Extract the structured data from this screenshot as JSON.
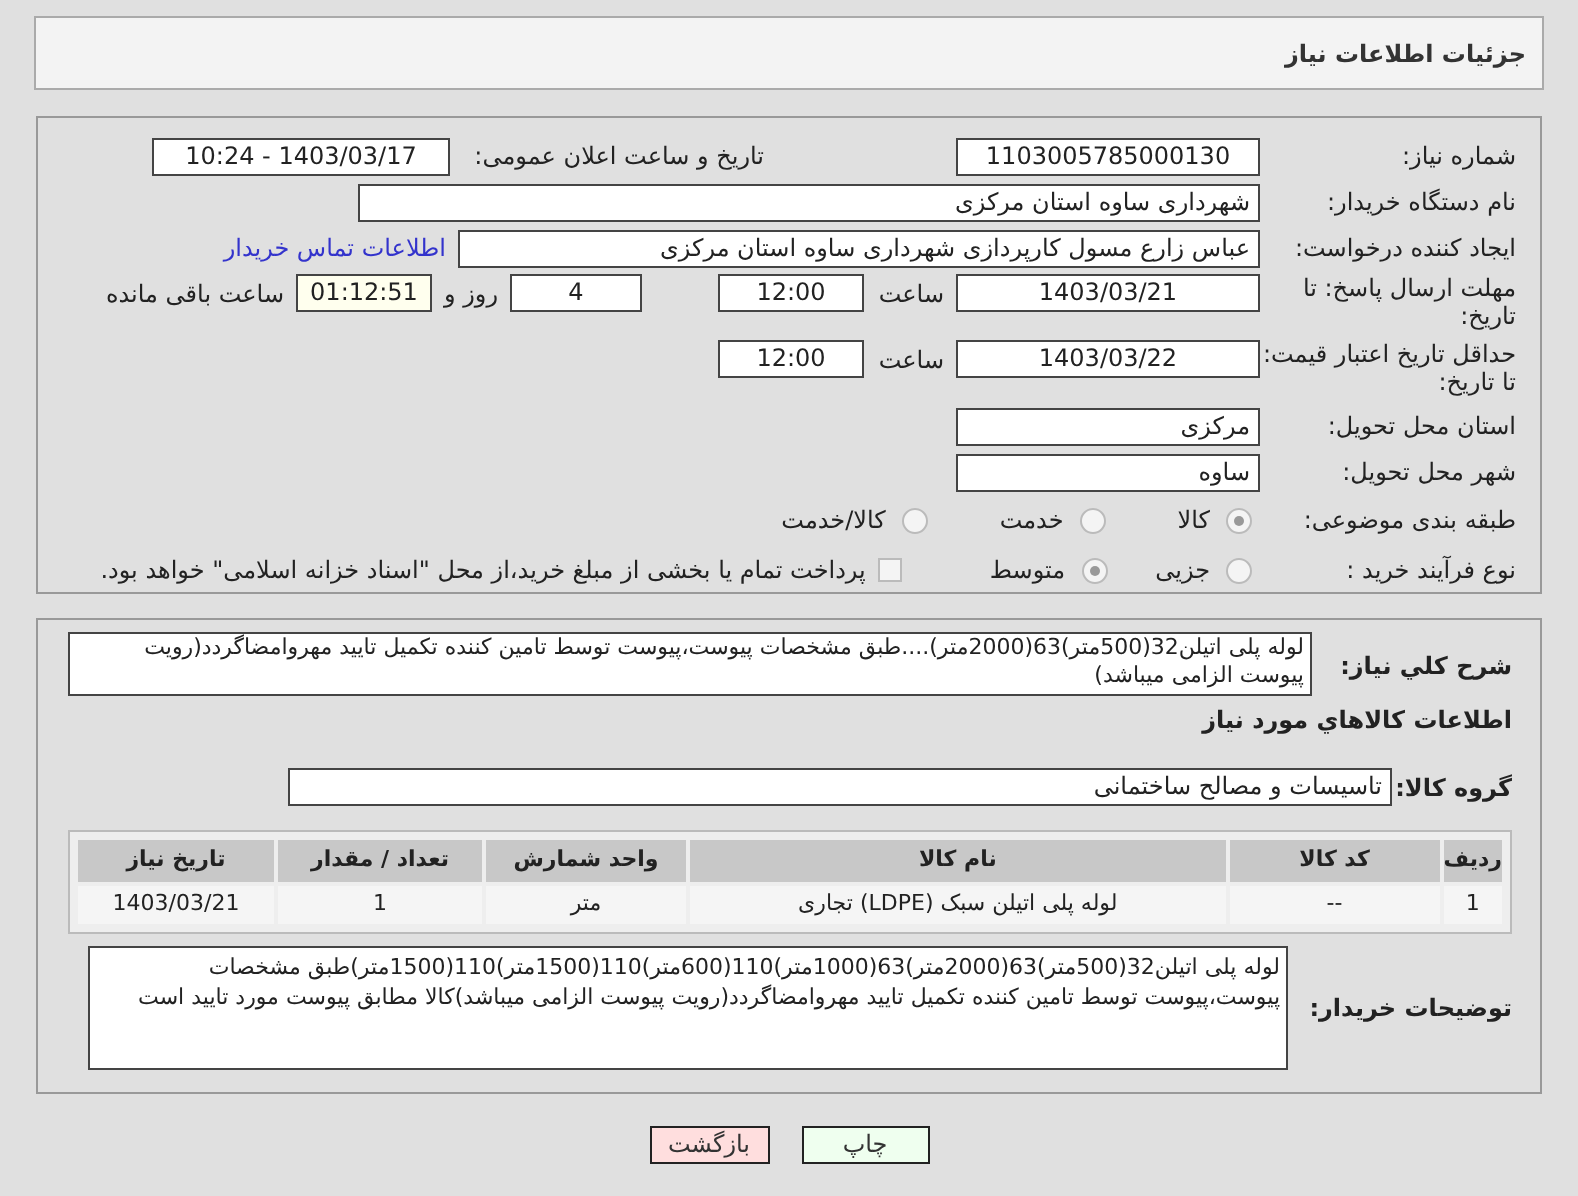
{
  "header": {
    "title": "جزئیات اطلاعات نیاز"
  },
  "need_number": {
    "label": "شماره نیاز:",
    "value": "1103005785000130"
  },
  "announce": {
    "label": "تاریخ و ساعت اعلان عمومی:",
    "value": "1403/03/17 - 10:24"
  },
  "buyer_org": {
    "label": "نام دستگاه خریدار:",
    "value": "شهرداری ساوه استان مرکزی"
  },
  "creator": {
    "label": "ایجاد کننده درخواست:",
    "value": "عباس زارع مسول کارپردازی شهرداری ساوه استان مرکزی",
    "link": "اطلاعات تماس خریدار"
  },
  "reply_deadline": {
    "label": "مهلت ارسال پاسخ: تا تاریخ:",
    "date": "1403/03/21",
    "time_label": "ساعت",
    "time": "12:00",
    "days": "4",
    "days_label": "روز و",
    "remaining": "01:12:51",
    "remaining_label": "ساعت باقی مانده"
  },
  "price_validity": {
    "label": "حداقل تاریخ اعتبار قیمت: تا تاریخ:",
    "date": "1403/03/22",
    "time_label": "ساعت",
    "time": "12:00"
  },
  "province": {
    "label": "استان محل تحویل:",
    "value": "مرکزی"
  },
  "city": {
    "label": "شهر محل تحویل:",
    "value": "ساوه"
  },
  "category": {
    "label": "طبقه بندی موضوعی:",
    "options": [
      {
        "label": "کالا",
        "selected": true
      },
      {
        "label": "خدمت",
        "selected": false
      },
      {
        "label": "کالا/خدمت",
        "selected": false
      }
    ]
  },
  "purchase_type": {
    "label": "نوع فرآیند خرید :",
    "options": [
      {
        "label": "جزیی",
        "selected": false
      },
      {
        "label": "متوسط",
        "selected": true
      }
    ],
    "payment_note": {
      "checked": false,
      "text": "پرداخت تمام یا بخشی از مبلغ خرید،از محل \"اسناد خزانه اسلامی\" خواهد بود."
    }
  },
  "summary": {
    "label": "شرح کلي نياز:",
    "value": "لوله پلی اتیلن32(500متر)63(2000متر)....طبق مشخصات پیوست،پیوست توسط تامین کننده تکمیل تایید مهروامضاگردد(رویت پیوست الزامی میباشد)"
  },
  "goods_heading": "اطلاعات کالاهاي مورد نياز",
  "goods_group": {
    "label": "گروه کالا:",
    "value": "تاسیسات و مصالح ساختمانی"
  },
  "table": {
    "columns": [
      "ردیف",
      "کد کالا",
      "نام کالا",
      "واحد شمارش",
      "تعداد / مقدار",
      "تاریخ نیاز"
    ],
    "rows": [
      [
        "1",
        "--",
        "لوله پلی اتیلن سبک (LDPE) تجاری",
        "متر",
        "1",
        "1403/03/21"
      ]
    ]
  },
  "buyer_notes": {
    "label": "توضیحات خریدار:",
    "value": "لوله پلی اتیلن32(500متر)63(2000متر)63(1000متر)110(600متر)110(1500متر)110(1500متر)طبق مشخصات پیوست،پیوست توسط تامین کننده تکمیل تایید مهروامضاگردد(رویت پیوست الزامی میباشد)کالا مطابق پیوست مورد تایید است"
  },
  "buttons": [
    {
      "label": "چاپ",
      "kind": "print"
    },
    {
      "label": "بازگشت",
      "kind": "back"
    }
  ]
}
